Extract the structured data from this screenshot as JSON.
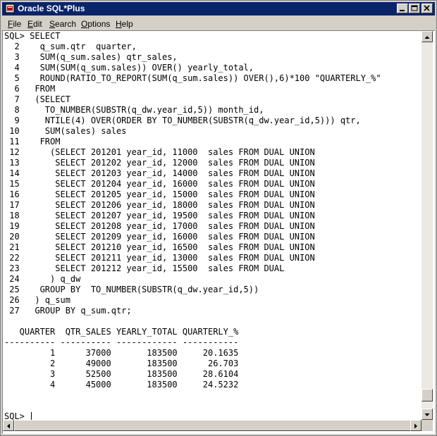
{
  "window": {
    "title": "Oracle SQL*Plus",
    "icon": "sqlplus-app-icon",
    "controls": [
      "minimize-icon",
      "maximize-icon",
      "close-icon"
    ]
  },
  "menu": [
    {
      "label": "File",
      "accel": "F"
    },
    {
      "label": "Edit",
      "accel": "E"
    },
    {
      "label": "Search",
      "accel": "S"
    },
    {
      "label": "Options",
      "accel": "O"
    },
    {
      "label": "Help",
      "accel": "H"
    }
  ],
  "console_lines": [
    "SQL> SELECT",
    "  2    q_sum.qtr  quarter,",
    "  3    SUM(q_sum.sales) qtr_sales,",
    "  4    SUM(SUM(q_sum.sales)) OVER() yearly_total,",
    "  5    ROUND(RATIO_TO_REPORT(SUM(q_sum.sales)) OVER(),6)*100 \"QUARTERLY_%\"",
    "  6   FROM",
    "  7   (SELECT",
    "  8     TO_NUMBER(SUBSTR(q_dw.year_id,5)) month_id,",
    "  9     NTILE(4) OVER(ORDER BY TO_NUMBER(SUBSTR(q_dw.year_id,5))) qtr,",
    " 10     SUM(sales) sales",
    " 11    FROM",
    " 12      (SELECT 201201 year_id, 11000  sales FROM DUAL UNION",
    " 13       SELECT 201202 year_id, 12000  sales FROM DUAL UNION",
    " 14       SELECT 201203 year_id, 14000  sales FROM DUAL UNION",
    " 15       SELECT 201204 year_id, 16000  sales FROM DUAL UNION",
    " 16       SELECT 201205 year_id, 15000  sales FROM DUAL UNION",
    " 17       SELECT 201206 year_id, 18000  sales FROM DUAL UNION",
    " 18       SELECT 201207 year_id, 19500  sales FROM DUAL UNION",
    " 19       SELECT 201208 year_id, 17000  sales FROM DUAL UNION",
    " 20       SELECT 201209 year_id, 16000  sales FROM DUAL UNION",
    " 21       SELECT 201210 year_id, 16500  sales FROM DUAL UNION",
    " 22       SELECT 201211 year_id, 13000  sales FROM DUAL UNION",
    " 23       SELECT 201212 year_id, 15500  sales FROM DUAL",
    " 24      ) q_dw",
    " 25    GROUP BY  TO_NUMBER(SUBSTR(q_dw.year_id,5))",
    " 26   ) q_sum",
    " 27   GROUP BY q_sum.qtr;",
    "",
    "   QUARTER  QTR_SALES YEARLY_TOTAL QUARTERLY_%",
    "---------- ---------- ------------ -----------",
    "         1      37000       183500     20.1635",
    "         2      49000       183500      26.703",
    "         3      52500       183500     28.6104",
    "         4      45000       183500     24.5232",
    "",
    "",
    "SQL> "
  ],
  "result_table": {
    "columns": [
      "QUARTER",
      "QTR_SALES",
      "YEARLY_TOTAL",
      "QUARTERLY_%"
    ],
    "rows": [
      [
        1,
        37000,
        183500,
        20.1635
      ],
      [
        2,
        49000,
        183500,
        26.703
      ],
      [
        3,
        52500,
        183500,
        28.6104
      ],
      [
        4,
        45000,
        183500,
        24.5232
      ]
    ]
  },
  "prompt": "SQL> ",
  "scrollbars": {
    "vertical_position": 0.98,
    "horizontal_position": 0.0
  },
  "colors": {
    "titlebar": "#0a246a",
    "chrome": "#d4d0c8",
    "console_bg": "#ffffff",
    "text": "#000000"
  }
}
